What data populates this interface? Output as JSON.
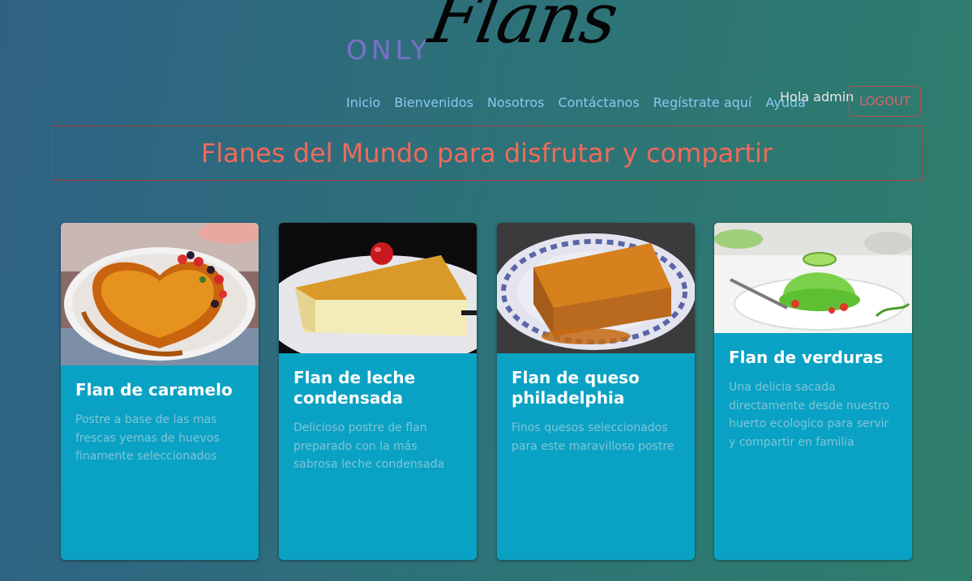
{
  "brand": {
    "prefix": "ONLY",
    "name": "Flans"
  },
  "nav": {
    "items": [
      {
        "label": "Inicio"
      },
      {
        "label": "Bienvenidos"
      },
      {
        "label": "Nosotros"
      },
      {
        "label": "Contáctanos"
      },
      {
        "label": "Regístrate aquí"
      },
      {
        "label": "Ayuda"
      }
    ],
    "greeting": "Hola admin",
    "logout_label": "LOGOUT"
  },
  "banner": {
    "title": "Flanes del Mundo para disfrutar y compartir"
  },
  "cards": [
    {
      "title": "Flan de caramelo",
      "text": "Postre a base de las mas frescas yemas de huevos finamente seleccionados"
    },
    {
      "title": "Flan de leche condensada",
      "text": "Delicioso postre de flan preparado con la más sabrosa leche condensada"
    },
    {
      "title": "Flan de queso philadelphia",
      "text": "Finos quesos seleccionados para este maravilloso postre"
    },
    {
      "title": "Flan de verduras",
      "text": "Una delicia sacada directamente desde nuestro huerto ecologico para servir y compartir en familia"
    }
  ],
  "colors": {
    "card_background": "#0aa2c4",
    "nav_link": "#8cc8f2",
    "banner_text": "#f06a5a",
    "logout_border": "#b64d4d"
  }
}
